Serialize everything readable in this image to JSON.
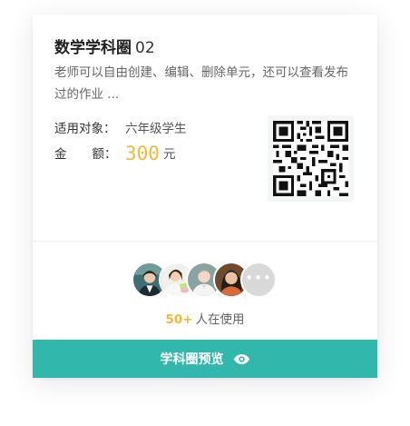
{
  "card": {
    "title": "数学学科圈",
    "title_number": "02",
    "description": "老师可以自由创建、编辑、删除单元，还可以查看发布过的作业 ...",
    "target_label": "适用对象：",
    "target_value": "六年级学生",
    "amount_label_1": "金",
    "amount_label_2": "额：",
    "amount_value": "300",
    "amount_unit": "元"
  },
  "users": {
    "count": "50+",
    "suffix": "人在使用",
    "more_glyph": "•••"
  },
  "preview_button": {
    "label": "学科圈预览",
    "icon": "eye-icon"
  },
  "colors": {
    "accent_teal": "#31b7ab",
    "price_gold": "#f5b93a"
  }
}
